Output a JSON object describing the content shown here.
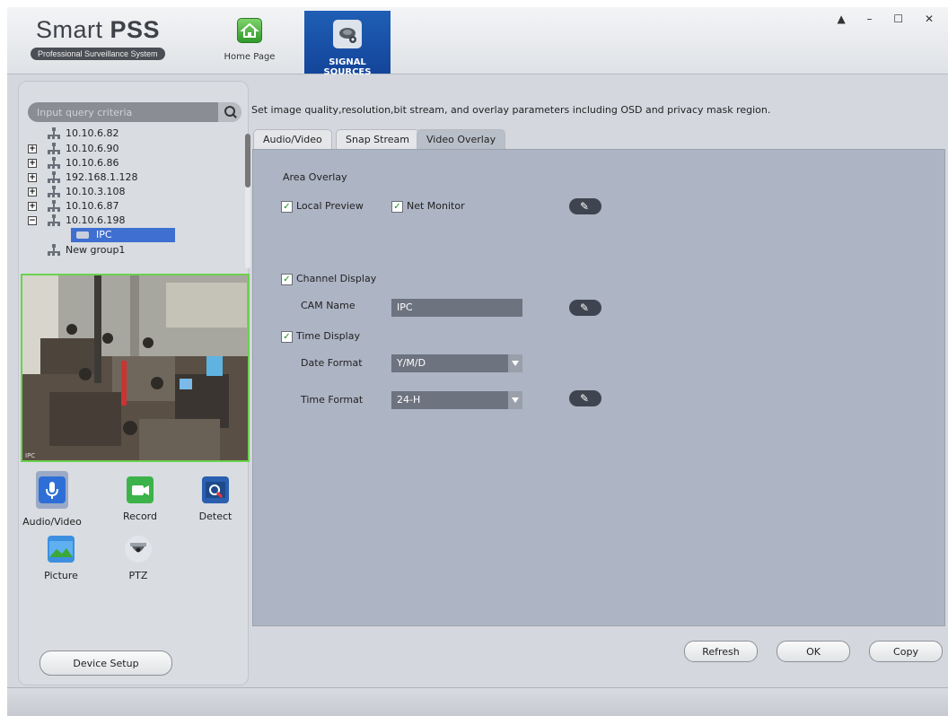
{
  "header": {
    "title_light": "Smart ",
    "title_bold": "PSS",
    "subtitle": "Professional Surveillance System",
    "nav": [
      {
        "label": "Home Page",
        "icon": "home-icon"
      },
      {
        "label": "SIGNAL SOURCES",
        "icon": "camera-icon",
        "active": true
      }
    ],
    "window_controls": "▲ – ☐ ✕"
  },
  "sidebar": {
    "search_placeholder": "Input query criteria",
    "tree": [
      {
        "label": "10.10.6.82",
        "expander": ""
      },
      {
        "label": "10.10.6.90",
        "expander": "+"
      },
      {
        "label": "10.10.6.86",
        "expander": "+"
      },
      {
        "label": "192.168.1.128",
        "expander": "+"
      },
      {
        "label": "10.10.3.108",
        "expander": "+"
      },
      {
        "label": "10.10.6.87",
        "expander": "+"
      },
      {
        "label": "10.10.6.198",
        "expander": "−"
      },
      {
        "label": "IPC",
        "selected": true
      },
      {
        "label": "New group1",
        "expander": ""
      }
    ],
    "preview_label": "IPC",
    "functions": [
      {
        "label": "Audio/Video",
        "icon": "microphone-icon",
        "active": true
      },
      {
        "label": "Record",
        "icon": "video-camera-icon"
      },
      {
        "label": "Detect",
        "icon": "detect-icon"
      },
      {
        "label": "Picture",
        "icon": "picture-icon"
      },
      {
        "label": "PTZ",
        "icon": "ptz-dome-icon"
      }
    ],
    "device_setup": "Device Setup"
  },
  "main": {
    "description": "Set image quality,resolution,bit stream, and overlay parameters including OSD and privacy mask region.",
    "tabs": [
      {
        "label": "Audio/Video"
      },
      {
        "label": "Snap Stream"
      },
      {
        "label": "Video Overlay",
        "active": true
      }
    ],
    "area_overlay": {
      "title": "Area Overlay",
      "local_preview": "Local Preview",
      "local_preview_checked": true,
      "net_monitor": "Net Monitor",
      "net_monitor_checked": true
    },
    "channel_display": {
      "label": "Channel Display",
      "checked": true,
      "cam_name_label": "CAM Name",
      "cam_name_value": "IPC"
    },
    "time_display": {
      "label": "Time Display",
      "checked": true,
      "date_format_label": "Date Format",
      "date_format_value": "Y/M/D",
      "time_format_label": "Time Format",
      "time_format_value": "24-H"
    },
    "buttons": {
      "refresh": "Refresh",
      "ok": "OK",
      "copy": "Copy"
    },
    "checkmark": "✓"
  },
  "colors": {
    "nav_active": "#1f5fb5",
    "selection": "#3f6fd0",
    "preview_border": "#6bd24e",
    "content_bg": "#adb4c4"
  }
}
